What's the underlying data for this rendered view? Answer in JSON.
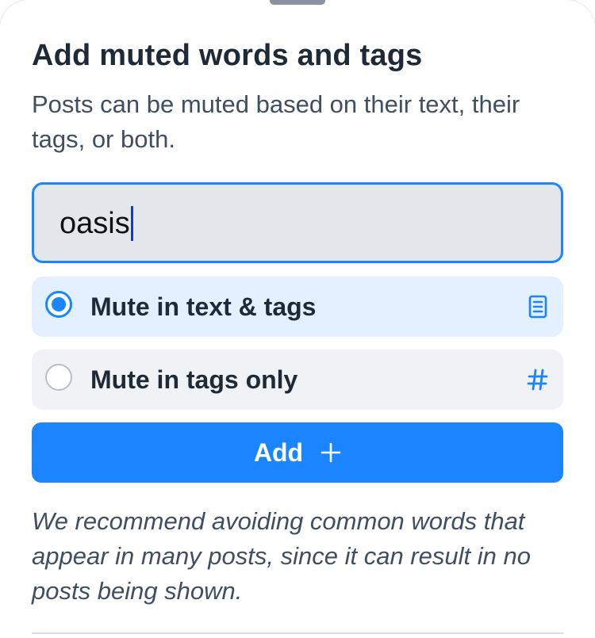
{
  "dialog": {
    "title": "Add muted words and tags",
    "description": "Posts can be muted based on their text, their tags, or both."
  },
  "input": {
    "value": "oasis"
  },
  "options": [
    {
      "label": "Mute in text & tags",
      "icon": "document-icon",
      "selected": true
    },
    {
      "label": "Mute in tags only",
      "icon": "hashtag-icon",
      "selected": false
    }
  ],
  "add_button": {
    "label": "Add",
    "icon": "plus-icon"
  },
  "note": "We recommend avoiding common words that appear in many posts, since it can result in no posts being shown.",
  "colors": {
    "accent": "#1a85ff",
    "selected_bg": "#e3f0ff",
    "unselected_bg": "#f0f2f5",
    "input_bg": "#e3e7ec",
    "text": "#1f2a37",
    "secondary_text": "#3f4f62"
  }
}
